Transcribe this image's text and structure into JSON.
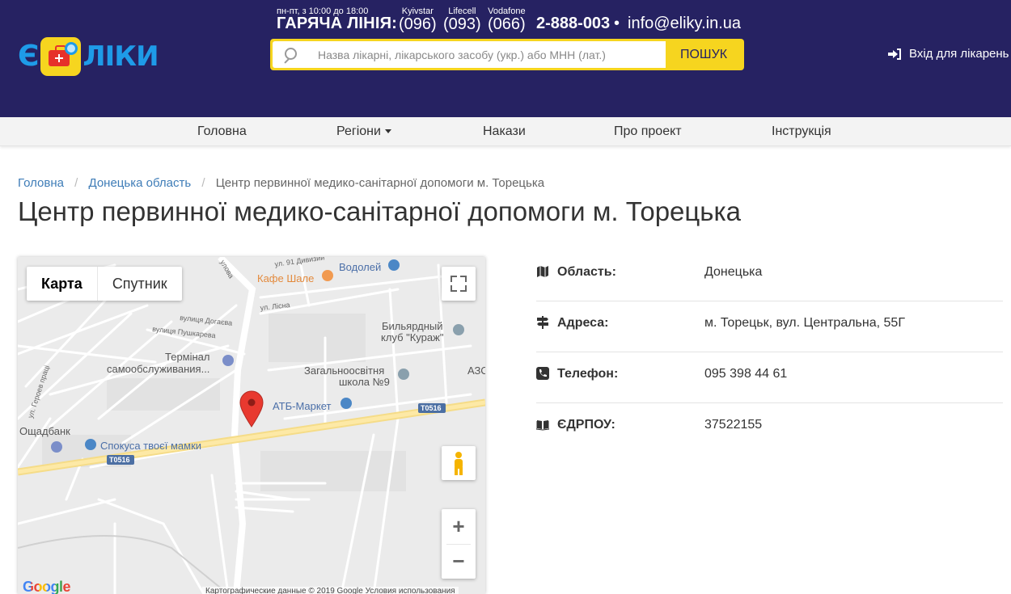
{
  "header": {
    "logo": {
      "prefix": "Є",
      "text": "ЛІКИ"
    },
    "hours": "пн-пт, з 10:00 до 18:00",
    "hotline_label": "ГАРЯЧА ЛІНІЯ:",
    "operators": [
      {
        "name": "Kyivstar",
        "code": "(096)"
      },
      {
        "name": "Lifecell",
        "code": "(093)"
      },
      {
        "name": "Vodafone",
        "code": "(066)"
      }
    ],
    "hotline_number": "2-888-003",
    "separator": "•",
    "email": "info@eliky.in.ua",
    "search": {
      "placeholder": "Назва лікарні, лікарського засобу (укр.) або МНН (лат.)",
      "button_label": "ПОШУК"
    },
    "login_label": "Вхід для лікарень"
  },
  "nav": {
    "items": [
      {
        "label": "Головна"
      },
      {
        "label": "Регіони",
        "has_dropdown": true
      },
      {
        "label": "Накази"
      },
      {
        "label": "Про проект"
      },
      {
        "label": "Інструкція"
      }
    ]
  },
  "breadcrumb": {
    "items": [
      "Головна",
      "Донецька область",
      "Центр первинної медико-санітарної допомоги м. Торецька"
    ],
    "separator": "/"
  },
  "page_title": "Центр первинної медико-санітарної допомоги м. Торецька",
  "map": {
    "type_buttons": [
      "Карта",
      "Спутник"
    ],
    "active_type": "Карта",
    "labels": {
      "kafe": "Кафе Шале",
      "vodolei": "Водолей",
      "street_91": "ул. 91 Дивизии",
      "street_lisna": "ул. Лісна",
      "street_dogaeva": "вулиця Догаєва",
      "street_pushkareva": "вулиця Пушкарева",
      "terminal_1": "Термінал",
      "terminal_2": "самообслуживания...",
      "billiard_1": "Бильярдный",
      "billiard_2": "клуб \"Кураж\"",
      "school_1": "Загальноосвітня",
      "school_2": "школа №9",
      "azs": "АЗС",
      "atb": "АТБ-Маркет",
      "road_1": "T0516",
      "road_2": "T0516",
      "oshchadbank": "Ощадбанк",
      "spokusa": "Спокуса твоєї мамки",
      "geroiv": "ул. Героев працi",
      "street_top": "улова"
    },
    "google_logo": "Google",
    "credit": "Картографические данные © 2019 Google   Условия использования",
    "zoom_in": "+",
    "zoom_out": "−"
  },
  "info": {
    "rows": [
      {
        "icon": "map-icon",
        "label": "Область:",
        "value": "Донецька"
      },
      {
        "icon": "signpost-icon",
        "label": "Адреса:",
        "value": "м. Торецьк, вул. Центральна, 55Г"
      },
      {
        "icon": "phone-icon",
        "label": "Телефон:",
        "value": "095 398 44 61"
      },
      {
        "icon": "book-icon",
        "label": "ЄДРПОУ:",
        "value": "37522155"
      }
    ]
  },
  "colors": {
    "header_bg": "#262262",
    "accent_yellow": "#f6d51f",
    "logo_blue": "#1e9be8",
    "link_blue": "#3e7cb7",
    "marker_red": "#e8392f"
  }
}
